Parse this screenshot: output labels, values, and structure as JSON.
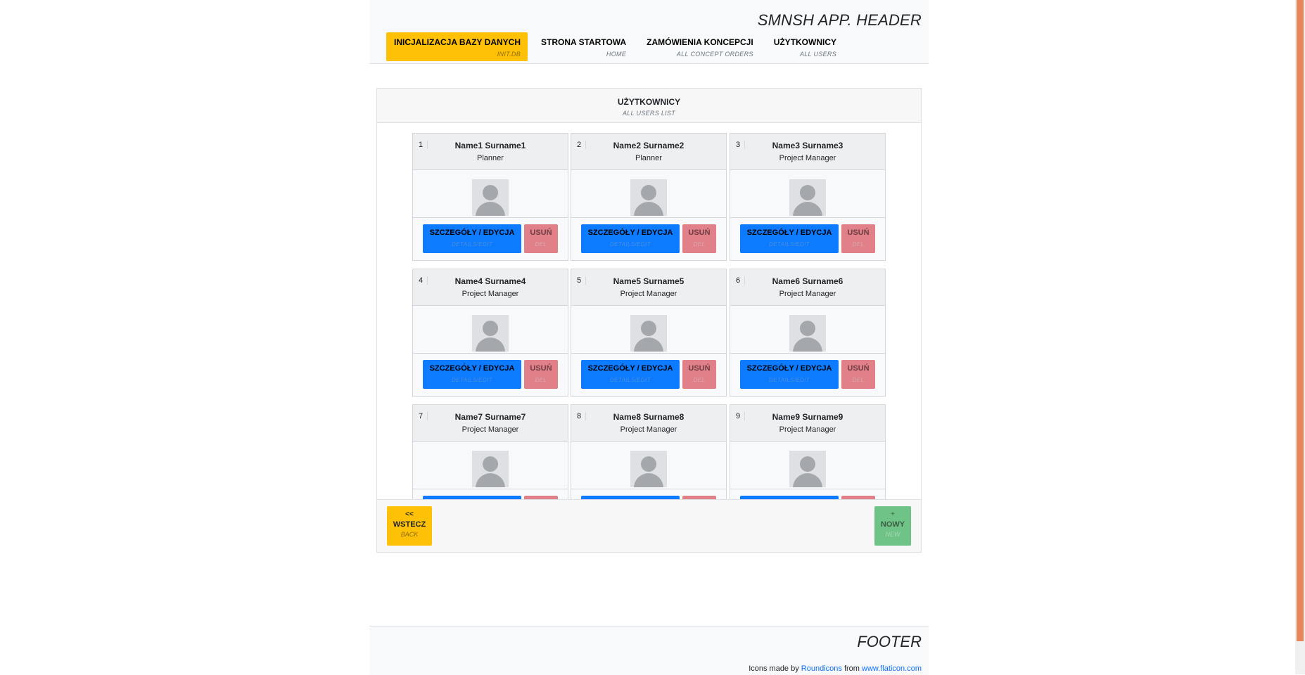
{
  "app": {
    "title": "SMNSH APP. HEADER"
  },
  "nav": [
    {
      "label": "INICJALIZACJA BAZY DANYCH",
      "sub": "INIT.DB",
      "active": true
    },
    {
      "label": "STRONA STARTOWA",
      "sub": "HOME"
    },
    {
      "label": "ZAMÓWIENIA KONCEPCJI",
      "sub": "ALL CONCEPT ORDERS"
    },
    {
      "label": "UŻYTKOWNICY",
      "sub": "ALL USERS"
    }
  ],
  "card": {
    "title": "UŻYTKOWNICY",
    "subtitle": "ALL USERS LIST"
  },
  "user_buttons": {
    "edit_label": "SZCZEGÓŁY / EDYCJA",
    "edit_sub": "DETAILS/EDIT",
    "del_label": "USUŃ",
    "del_sub": "DEL"
  },
  "users": [
    {
      "num": "1",
      "name": "Name1 Surname1",
      "role": "Planner"
    },
    {
      "num": "2",
      "name": "Name2 Surname2",
      "role": "Planner"
    },
    {
      "num": "3",
      "name": "Name3 Surname3",
      "role": "Project Manager"
    },
    {
      "num": "4",
      "name": "Name4 Surname4",
      "role": "Project Manager"
    },
    {
      "num": "5",
      "name": "Name5 Surname5",
      "role": "Project Manager"
    },
    {
      "num": "6",
      "name": "Name6 Surname6",
      "role": "Project Manager"
    },
    {
      "num": "7",
      "name": "Name7 Surname7",
      "role": "Project Manager"
    },
    {
      "num": "8",
      "name": "Name8 Surname8",
      "role": "Project Manager"
    },
    {
      "num": "9",
      "name": "Name9 Surname9",
      "role": "Project Manager"
    }
  ],
  "back": {
    "arrow": "<<",
    "label": "WSTECZ",
    "sub": "BACK"
  },
  "new": {
    "plus": "+",
    "label": "NOWY",
    "sub": "NEW"
  },
  "footer": {
    "title": "FOOTER",
    "credit_prefix": "Icons made by",
    "credit_author": "Roundicons",
    "credit_mid": "from",
    "credit_site": "www.flaticon.com"
  },
  "colors": {
    "nav_active": "#ffc107",
    "edit_button": "#0d7bff",
    "delete_button": "#e2808a",
    "back_button": "#ffc107",
    "new_button": "#6fc387",
    "scrollbar_thumb": "#e8865a"
  }
}
